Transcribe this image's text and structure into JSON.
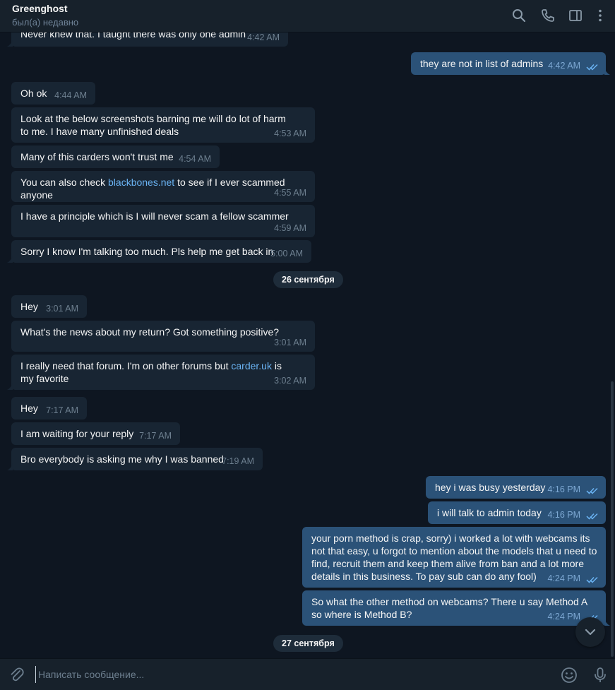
{
  "header": {
    "title": "Greenghost",
    "status": "был(а) недавно",
    "icons": [
      "search-icon",
      "phone-icon",
      "sidebar-toggle-icon",
      "more-vertical-icon"
    ]
  },
  "messages": [
    {
      "dir": "in",
      "text": "Never knew that. I taught there was only one admin",
      "time": "4:42 AM"
    },
    {
      "dir": "out",
      "text": "they are not in list of admins",
      "time": "4:42 AM"
    },
    {
      "dir": "in",
      "text": "Oh ok",
      "time": "4:44 AM"
    },
    {
      "dir": "in",
      "text": "Look at the below screenshots barning me will do lot of harm to me. I have many unfinished deals",
      "time": "4:53 AM"
    },
    {
      "dir": "in",
      "text": "Many of this carders won't trust me",
      "time": "4:54 AM"
    },
    {
      "dir": "in",
      "text_before": "You can also check ",
      "link": "blackbones.net",
      "text_after": " to see if I ever scammed anyone",
      "time": "4:55 AM"
    },
    {
      "dir": "in",
      "text": "I have a principle which is I will never scam a fellow scammer",
      "time": "4:59 AM"
    },
    {
      "dir": "in",
      "text": "Sorry I know I'm talking too much. Pls help me get back in",
      "time": "5:00 AM"
    },
    {
      "dir": "in",
      "text": "Hey",
      "time": "3:01 AM"
    },
    {
      "dir": "in",
      "text": "What's the news about my return? Got something positive?",
      "time": "3:01 AM"
    },
    {
      "dir": "in",
      "text_before": "I really need that forum. I'm on other forums but ",
      "link": "carder.uk",
      "text_after": " is my favorite",
      "time": "3:02 AM"
    },
    {
      "dir": "in",
      "text": "Hey",
      "time": "7:17 AM"
    },
    {
      "dir": "in",
      "text": "I am waiting for your reply",
      "time": "7:17 AM"
    },
    {
      "dir": "in",
      "text": "Bro everybody is asking me why I was banned",
      "time": "7:19 AM"
    },
    {
      "dir": "out",
      "text": "hey i was busy yesterday",
      "time": "4:16 PM"
    },
    {
      "dir": "out",
      "text": "i will talk to admin today",
      "time": "4:16 PM"
    },
    {
      "dir": "out",
      "text": "your porn method is crap, sorry) i worked a lot with webcams its not that easy, u forgot to mention about the models that u need to find, recruit them and keep them alive from ban and a lot more details in this business. To pay sub can do any fool)",
      "time": "4:24 PM"
    },
    {
      "dir": "out",
      "text": "So what the other method on webcams? There u say Method A so where is Method B?",
      "time": "4:24 PM"
    }
  ],
  "date_separators": [
    "26 сентября",
    "27 сентября"
  ],
  "composer": {
    "placeholder": "Написать сообщение...",
    "icons": [
      "attach-icon",
      "emoji-icon",
      "microphone-icon"
    ]
  },
  "colors": {
    "background": "#0e1621",
    "incoming_bubble": "#182533",
    "outgoing_bubble": "#2b5278",
    "link": "#6ab3f3",
    "read_checks": "#6ab3f3"
  }
}
